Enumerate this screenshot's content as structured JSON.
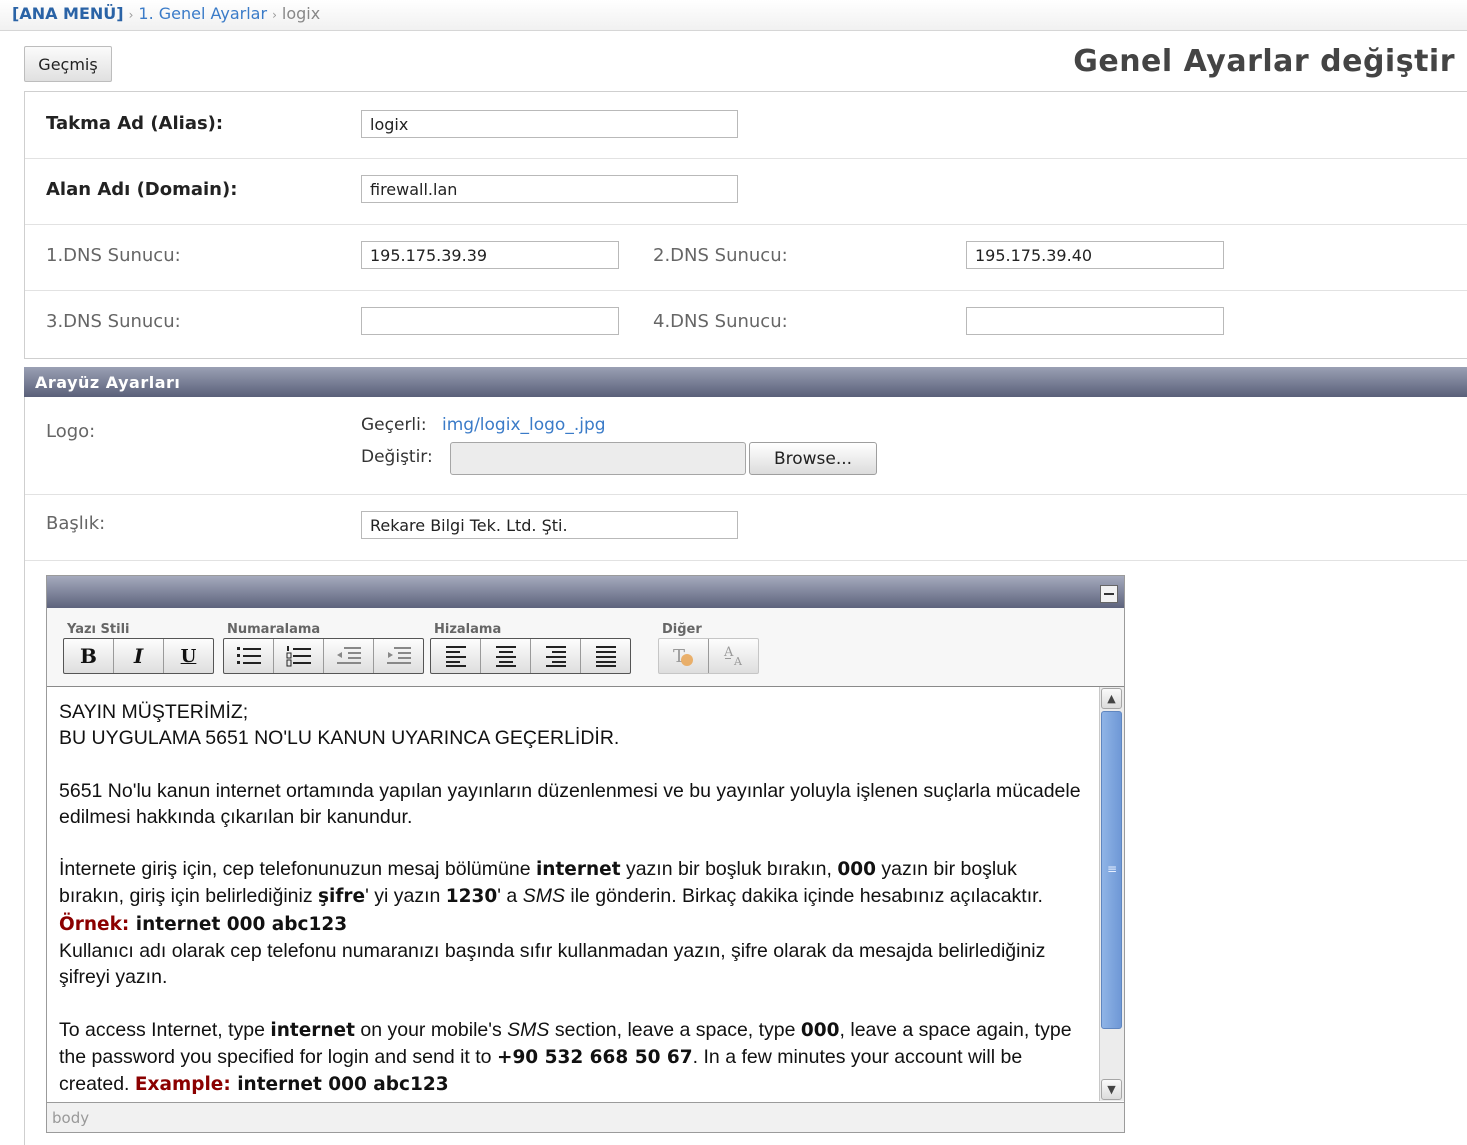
{
  "breadcrumb": {
    "root": "[ANA MENÜ]",
    "item1": "1. Genel Ayarlar",
    "item2": "logix",
    "separator": "›"
  },
  "toolbar": {
    "history_label": "Geçmiş"
  },
  "page": {
    "title": "Genel Ayarlar değiştir"
  },
  "general": {
    "alias_label": "Takma Ad (Alias):",
    "alias_value": "logix",
    "domain_label": "Alan Adı (Domain):",
    "domain_value": "firewall.lan",
    "dns1_label": "1.DNS Sunucu:",
    "dns1_value": "195.175.39.39",
    "dns2_label": "2.DNS Sunucu:",
    "dns2_value": "195.175.39.40",
    "dns3_label": "3.DNS Sunucu:",
    "dns3_value": "",
    "dns4_label": "4.DNS Sunucu:",
    "dns4_value": ""
  },
  "interface": {
    "section_title": "Arayüz Ayarları",
    "logo_label": "Logo:",
    "current_label": "Geçerli:",
    "current_link": "img/logix_logo_.jpg",
    "change_label": "Değiştir:",
    "browse_label": "Browse...",
    "title_label": "Başlık:",
    "title_value": "Rekare Bilgi Tek. Ltd. Şti."
  },
  "editor": {
    "groups": {
      "style": "Yazı Stili",
      "numbering": "Numaralama",
      "align": "Hizalama",
      "other": "Diğer"
    },
    "buttons": {
      "bold": "B",
      "italic": "I",
      "underline": "U"
    },
    "status": "body",
    "content": {
      "p1_line1": "SAYIN MÜŞTERİMİZ;",
      "p1_line2": "BU UYGULAMA 5651 NO'LU KANUN UYARINCA GEÇERLİDİR.",
      "p2": "5651 No'lu kanun internet ortamında yapılan yayınların düzenlenmesi ve bu yayınlar yoluyla işlenen suçlarla mücadele edilmesi hakkında çıkarılan bir kanundur.",
      "p3_a": "İnternete giriş için, cep telefonunuzun mesaj bölümüne ",
      "p3_b": "internet",
      "p3_c": " yazın bir boşluk bırakın, ",
      "p3_d": "000",
      "p3_e": " yazın bir boşluk bırakın, giriş için belirlediğiniz ",
      "p3_f": "şifre",
      "p3_g": "' yi yazın ",
      "p3_h": "1230",
      "p3_i": "' a ",
      "p3_j": "SMS",
      "p3_k": " ile gönderin. Birkaç dakika içinde hesabınız açılacaktır.  ",
      "p3_l": "Örnek:",
      "p3_m": "  internet 000 abc123",
      "p3_n": "Kullanıcı adı olarak cep telefonu numaranızı başında sıfır kullanmadan yazın, şifre olarak da mesajda belirlediğiniz şifreyi yazın.",
      "p4_a": "To access Internet, type ",
      "p4_b": "internet",
      "p4_c": " on your mobile's ",
      "p4_d": "SMS",
      "p4_e": " section, leave a space, type ",
      "p4_f": "000",
      "p4_g": ", leave a space again, type the password you specified for login and send it to ",
      "p4_h": "+90 532 668 50 67",
      "p4_i": ". In a few minutes your account will be created. ",
      "p4_j": "Example:",
      "p4_k": " internet 000 abc123"
    }
  }
}
